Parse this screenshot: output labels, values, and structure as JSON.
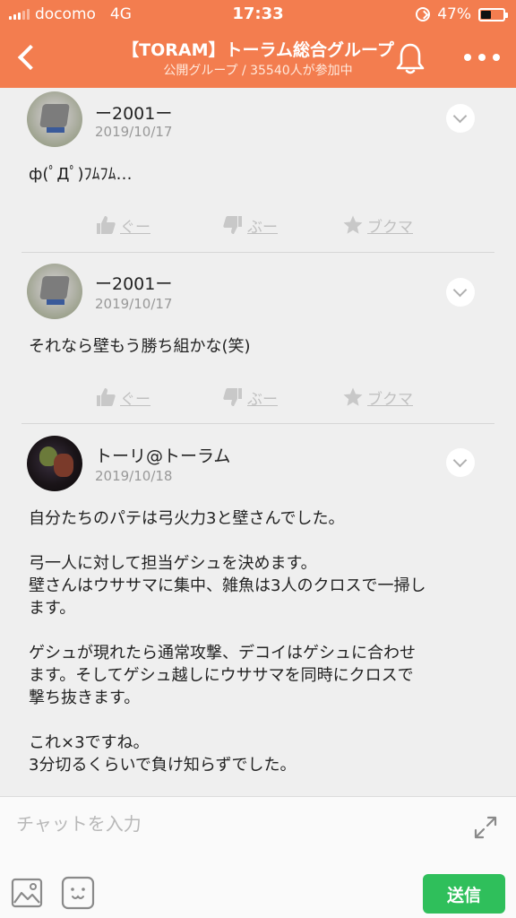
{
  "status_bar": {
    "carrier": "docomo",
    "network": "4G",
    "time": "17:33",
    "battery": "47%",
    "battery_level": 0.47
  },
  "header": {
    "title": "【TORAM】トーラム総合グループ",
    "subtitle": "公開グループ / 35540人が参加中"
  },
  "posts": [
    {
      "user": "ー2001ー",
      "date": "2019/10/17",
      "body": "ф(ﾟДﾟ)ﾌﾑﾌﾑ…",
      "avatar": "gray-block-avatar"
    },
    {
      "user": "ー2001ー",
      "date": "2019/10/17",
      "body": "それなら壁もう勝ち組かな(笑)",
      "avatar": "gray-block-avatar"
    },
    {
      "user": "トーリ@トーラム",
      "date": "2019/10/18",
      "body": "自分たちのパテは弓火力3と壁さんでした。\n\n弓一人に対して担当ゲシュを決めます。\n壁さんはウササマに集中、雑魚は3人のクロスで一掃し\nます。\n\nゲシュが現れたら通常攻撃、デコイはゲシュに合わせ\nます。そしてゲシュ越しにウササマを同時にクロスで\n撃ち抜きます。\n\nこれ×3ですね。\n3分切るくらいで負け知らずでした。",
      "avatar": "dark-character-avatar"
    }
  ],
  "actions": {
    "like": "ぐー",
    "dislike": "ぶー",
    "bookmark": "ブクマ"
  },
  "chat": {
    "placeholder": "チャットを入力",
    "send": "送信"
  },
  "colors": {
    "brand": "#f37d4f",
    "send": "#2fbf5b",
    "muted": "#c0c0c0"
  }
}
